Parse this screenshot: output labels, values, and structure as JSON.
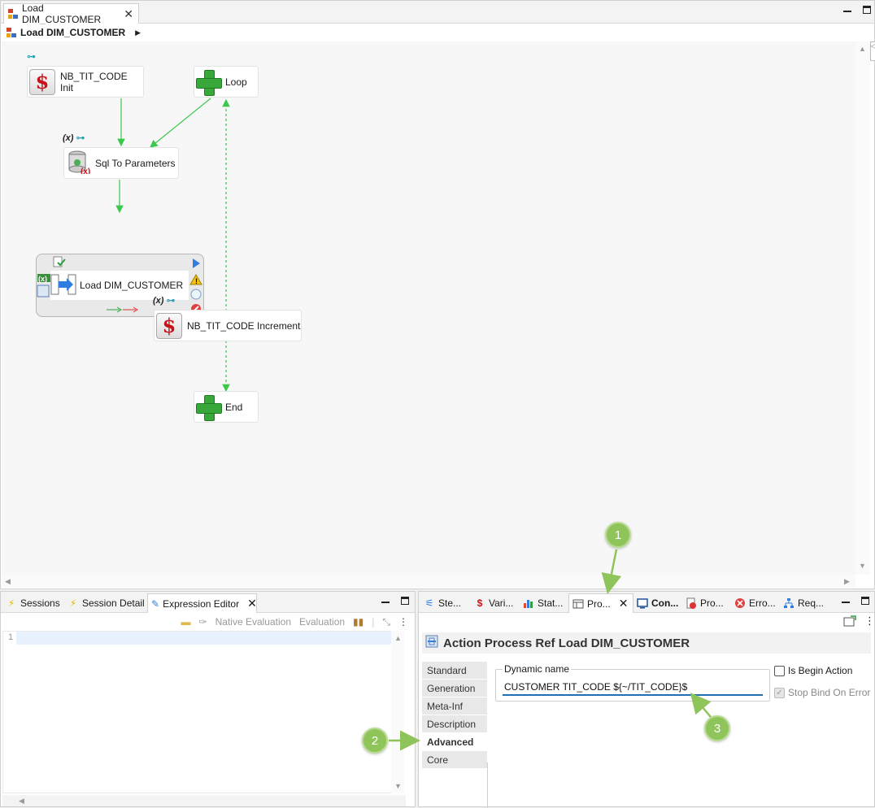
{
  "editor": {
    "tab_label": "Load DIM_CUSTOMER",
    "breadcrumb": "Load DIM_CUSTOMER"
  },
  "diagram": {
    "nodes": {
      "init": "NB_TIT_CODE Init",
      "loop": "Loop",
      "sql": "Sql To Parameters",
      "load": "Load DIM_CUSTOMER",
      "increment": "NB_TIT_CODE Increment",
      "end": "End"
    },
    "var_badge": "(x)"
  },
  "left_panel": {
    "tabs": [
      "Sessions",
      "Session Detail",
      "Expression Editor"
    ],
    "toolbar": {
      "native_evaluation": "Native Evaluation",
      "evaluation": "Evaluation"
    },
    "line_number": "1"
  },
  "right_panel": {
    "tabs": [
      "Ste...",
      "Vari...",
      "Stat...",
      "Pro...",
      "Con...",
      "Pro...",
      "Erro...",
      "Req..."
    ],
    "title": "Action Process Ref Load DIM_CUSTOMER",
    "nav": [
      "Standard",
      "Generation",
      "Meta-Inf",
      "Description",
      "Advanced",
      "Core"
    ],
    "dynamic_name_label": "Dynamic name",
    "dynamic_name_value": "CUSTOMER TIT_CODE ${~/TIT_CODE}$",
    "is_begin_action": "Is Begin Action",
    "stop_bind_on_error": "Stop Bind On Error"
  },
  "callouts": [
    "1",
    "2",
    "3"
  ],
  "colors": {
    "flow_arrow": "#3cc84a",
    "callout": "#8fc45a",
    "input_underline": "#1f6fb5"
  }
}
